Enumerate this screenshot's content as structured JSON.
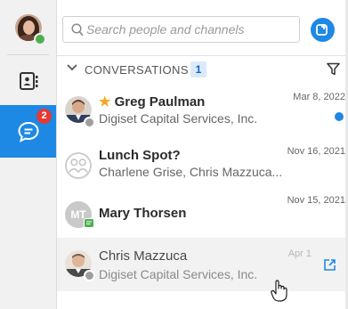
{
  "search": {
    "placeholder": "Search people and channels"
  },
  "rail": {
    "chat_badge": "2"
  },
  "conversations": {
    "header": "CONVERSATIONS",
    "count": "1",
    "items": [
      {
        "star": "★",
        "name": "Greg Paulman",
        "subtitle": "Digiset Capital Services, Inc.",
        "date": "Mar 8, 2022",
        "unread": true
      },
      {
        "name": "Lunch Spot?",
        "subtitle": "Charlene Grise, Chris Mazzuca...",
        "date": "Nov 16, 2021"
      },
      {
        "initials": "MT",
        "name": "Mary Thorsen",
        "subtitle": "",
        "date": "Nov 15, 2021"
      },
      {
        "name": "Chris Mazzuca",
        "subtitle": "Digiset Capital Services, Inc.",
        "date": "Apr 1"
      }
    ]
  },
  "colors": {
    "accent": "#1e88e5",
    "badge": "#e53935",
    "star": "#f5a623",
    "presence": "#4caf50"
  },
  "icons": [
    "contacts-icon",
    "chat-icon",
    "search-icon",
    "compose-icon",
    "chevron-down-icon",
    "filter-icon",
    "open-external-icon",
    "hand-cursor-icon"
  ]
}
